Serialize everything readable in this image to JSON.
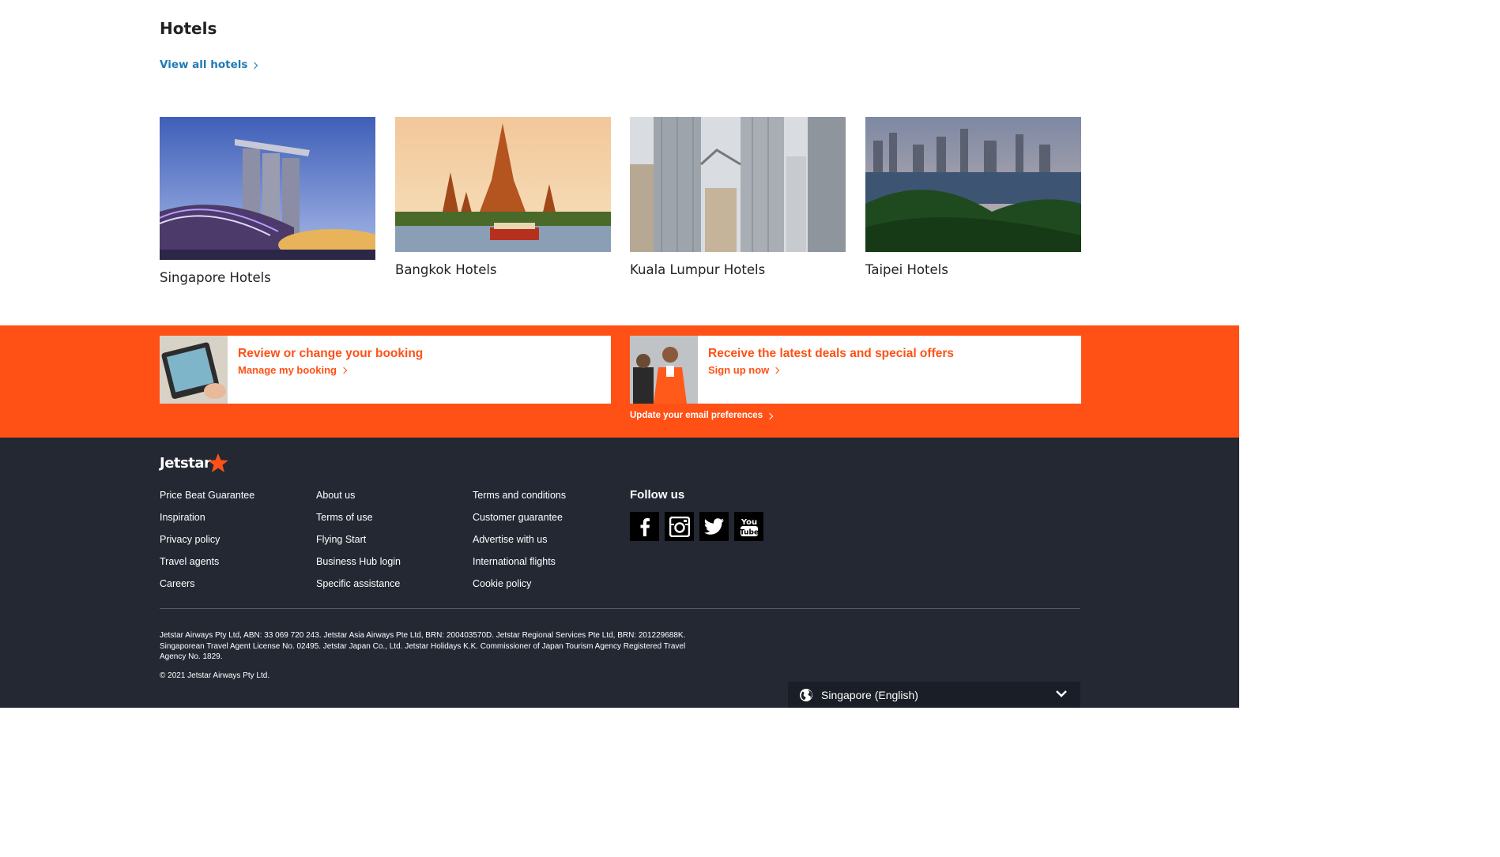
{
  "hotels": {
    "title": "Hotels",
    "view_all": "View all hotels",
    "cards": [
      {
        "label": "Singapore Hotels"
      },
      {
        "label": "Bangkok Hotels"
      },
      {
        "label": "Kuala Lumpur Hotels"
      },
      {
        "label": "Taipei Hotels"
      }
    ]
  },
  "promos": {
    "booking": {
      "title": "Review or change your booking",
      "link": "Manage my booking"
    },
    "deals": {
      "title": "Receive the latest deals and special offers",
      "link": "Sign up now"
    },
    "email_pref": "Update your email preferences"
  },
  "footer": {
    "logo": "Jetstar",
    "col1": [
      "Price Beat Guarantee",
      "Inspiration",
      "Privacy policy",
      "Travel agents",
      "Careers"
    ],
    "col2": [
      "About us",
      "Terms of use",
      "Flying Start",
      "Business Hub login",
      "Specific assistance"
    ],
    "col3": [
      "Terms and conditions",
      "Customer guarantee",
      "Advertise with us",
      "International flights",
      "Cookie policy"
    ],
    "follow_us": "Follow us",
    "social": [
      "facebook-icon",
      "instagram-icon",
      "twitter-icon",
      "youtube-icon"
    ],
    "legal": "Jetstar Airways Pty Ltd, ABN: 33 069 720 243. Jetstar Asia Airways Pte Ltd, BRN: 200403570D. Jetstar Regional Services Pte Ltd, BRN: 201229688K. Singaporean Travel Agent License No. 02495. Jetstar Japan Co., Ltd. Jetstar Holidays K.K. Commissioner of Japan Tourism Agency Registered Travel Agency No. 1829.",
    "copyright": "© 2021 Jetstar Airways Pty Ltd.",
    "region": "Singapore (English)"
  },
  "colors": {
    "brand_orange": "#ff5115",
    "footer_bg": "#232833",
    "link_blue": "#1f7ab3"
  }
}
